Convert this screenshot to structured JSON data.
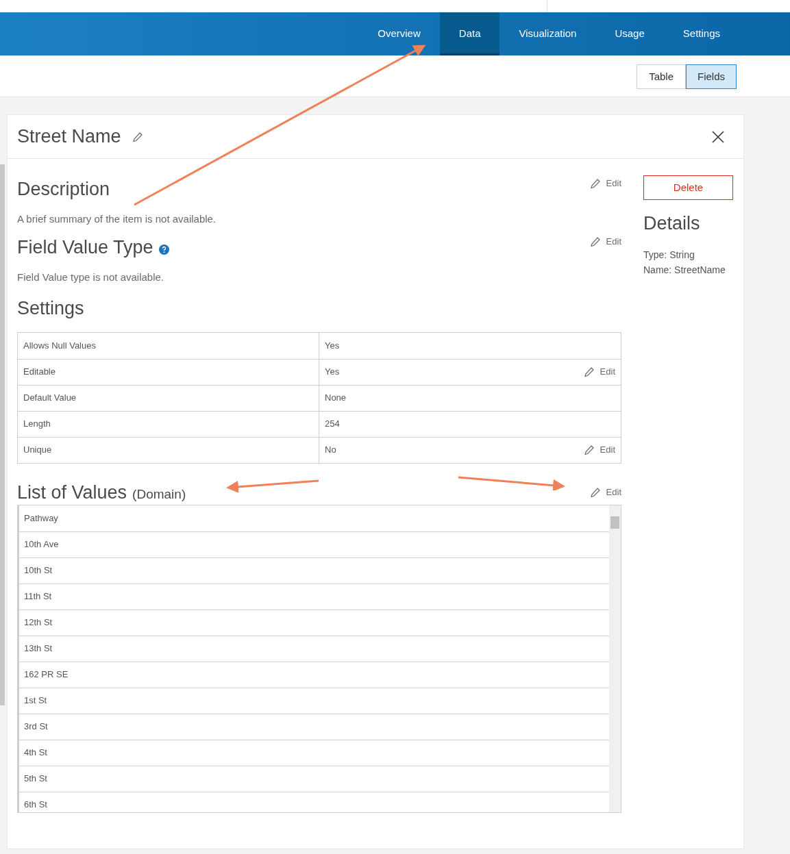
{
  "nav": {
    "tabs": [
      {
        "label": "Overview",
        "selected": false
      },
      {
        "label": "Data",
        "selected": true
      },
      {
        "label": "Visualization",
        "selected": false
      },
      {
        "label": "Usage",
        "selected": false
      },
      {
        "label": "Settings",
        "selected": false
      }
    ]
  },
  "view_toggle": [
    {
      "label": "Table",
      "selected": false
    },
    {
      "label": "Fields",
      "selected": true
    }
  ],
  "field_panel": {
    "title": "Street Name",
    "description": {
      "heading": "Description",
      "edit": "Edit",
      "text": "A brief summary of the item is not available."
    },
    "field_value_type": {
      "heading": "Field Value Type",
      "edit": "Edit",
      "text": "Field Value type is not available."
    },
    "settings": {
      "heading": "Settings",
      "rows": [
        {
          "label": "Allows Null Values",
          "value": "Yes"
        },
        {
          "label": "Editable",
          "value": "Yes",
          "edit": "Edit"
        },
        {
          "label": "Default Value",
          "value": "None"
        },
        {
          "label": "Length",
          "value": "254"
        },
        {
          "label": "Unique",
          "value": "No",
          "edit": "Edit"
        }
      ]
    },
    "list_of_values": {
      "heading": "List of Values",
      "subheading": "(Domain)",
      "edit": "Edit",
      "values": [
        "Pathway",
        "10th Ave",
        "10th St",
        "11th St",
        "12th St",
        "13th St",
        "162 PR SE",
        "1st St",
        "3rd St",
        "4th St",
        "5th St",
        "6th St"
      ]
    },
    "delete_button": "Delete",
    "details": {
      "heading": "Details",
      "lines": [
        "Type: String",
        "Name: StreetName"
      ]
    }
  }
}
